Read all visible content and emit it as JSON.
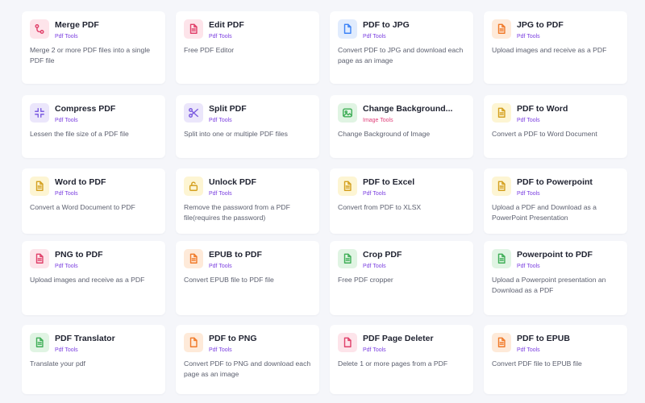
{
  "colors": {
    "background": "#f5f6fa",
    "card": "#ffffff",
    "title": "#1f2230",
    "description": "#5b5f6e",
    "category_pdf": "#7b3fe0",
    "category_image": "#e0407a"
  },
  "tools": [
    {
      "title": "Merge PDF",
      "category": "Pdf Tools",
      "description": "Merge 2 or more PDF files into a single PDF file",
      "icon": "merge-icon",
      "icon_bg": "#fde4ea",
      "icon_color": "#e0406a"
    },
    {
      "title": "Edit PDF",
      "category": "Pdf Tools",
      "description": "Free PDF Editor",
      "icon": "file-text-icon",
      "icon_bg": "#fde4ea",
      "icon_color": "#e0406a"
    },
    {
      "title": "PDF to JPG",
      "category": "Pdf Tools",
      "description": "Convert PDF to JPG and download each page as an image",
      "icon": "file-icon",
      "icon_bg": "#e1ecfd",
      "icon_color": "#3b82f6"
    },
    {
      "title": "JPG to PDF",
      "category": "Pdf Tools",
      "description": "Upload images and receive as a PDF",
      "icon": "file-text-icon",
      "icon_bg": "#feead9",
      "icon_color": "#f07a2a"
    },
    {
      "title": "Compress PDF",
      "category": "Pdf Tools",
      "description": "Lessen the file size of a PDF file",
      "icon": "compress-icon",
      "icon_bg": "#ebe6fb",
      "icon_color": "#7c5ce0"
    },
    {
      "title": "Split PDF",
      "category": "Pdf Tools",
      "description": "Split into one or multiple PDF files",
      "icon": "scissors-icon",
      "icon_bg": "#ebe6fb",
      "icon_color": "#7c5ce0"
    },
    {
      "title": "Change Background...",
      "category": "Image Tools",
      "description": "Change Background of Image",
      "icon": "image-icon",
      "icon_bg": "#e0f4e3",
      "icon_color": "#3fae57"
    },
    {
      "title": "PDF to Word",
      "category": "Pdf Tools",
      "description": "Convert a PDF to Word Document",
      "icon": "file-text-icon",
      "icon_bg": "#fdf5d3",
      "icon_color": "#d4a020"
    },
    {
      "title": "Word to PDF",
      "category": "Pdf Tools",
      "description": "Convert a Word Document to PDF",
      "icon": "file-text-icon",
      "icon_bg": "#fdf5d3",
      "icon_color": "#d4a020"
    },
    {
      "title": "Unlock PDF",
      "category": "Pdf Tools",
      "description": "Remove the password from a PDF file(requires the password)",
      "icon": "unlock-icon",
      "icon_bg": "#fdf5d3",
      "icon_color": "#d4a020"
    },
    {
      "title": "PDF to Excel",
      "category": "Pdf Tools",
      "description": "Convert from PDF to XLSX",
      "icon": "file-text-icon",
      "icon_bg": "#fdf5d3",
      "icon_color": "#d4a020"
    },
    {
      "title": "PDF to Powerpoint",
      "category": "Pdf Tools",
      "description": "Upload a PDF and Download as a PowerPoint Presentation",
      "icon": "file-text-icon",
      "icon_bg": "#fdf5d3",
      "icon_color": "#d4a020"
    },
    {
      "title": "PNG to PDF",
      "category": "Pdf Tools",
      "description": "Upload images and receive as a PDF",
      "icon": "file-text-icon",
      "icon_bg": "#fde4ea",
      "icon_color": "#e0406a"
    },
    {
      "title": "EPUB to PDF",
      "category": "Pdf Tools",
      "description": "Convert EPUB file to PDF file",
      "icon": "file-text-icon",
      "icon_bg": "#feead9",
      "icon_color": "#f07a2a"
    },
    {
      "title": "Crop PDF",
      "category": "Pdf Tools",
      "description": "Free PDF cropper",
      "icon": "file-text-icon",
      "icon_bg": "#e0f4e3",
      "icon_color": "#3fae57"
    },
    {
      "title": "Powerpoint to PDF",
      "category": "Pdf Tools",
      "description": "Upload a Powerpoint presentation an Download as a PDF",
      "icon": "file-text-icon",
      "icon_bg": "#e0f4e3",
      "icon_color": "#3fae57"
    },
    {
      "title": "PDF Translator",
      "category": "Pdf Tools",
      "description": "Translate your pdf",
      "icon": "file-text-icon",
      "icon_bg": "#e0f4e3",
      "icon_color": "#3fae57"
    },
    {
      "title": "PDF to PNG",
      "category": "Pdf Tools",
      "description": "Convert PDF to PNG and download each page as an image",
      "icon": "file-icon",
      "icon_bg": "#feead9",
      "icon_color": "#f07a2a"
    },
    {
      "title": "PDF Page Deleter",
      "category": "Pdf Tools",
      "description": "Delete 1 or more pages from a PDF",
      "icon": "file-icon",
      "icon_bg": "#fde4ea",
      "icon_color": "#e0406a"
    },
    {
      "title": "PDF to EPUB",
      "category": "Pdf Tools",
      "description": "Convert PDF file to EPUB file",
      "icon": "file-text-icon",
      "icon_bg": "#feead9",
      "icon_color": "#f07a2a"
    }
  ]
}
